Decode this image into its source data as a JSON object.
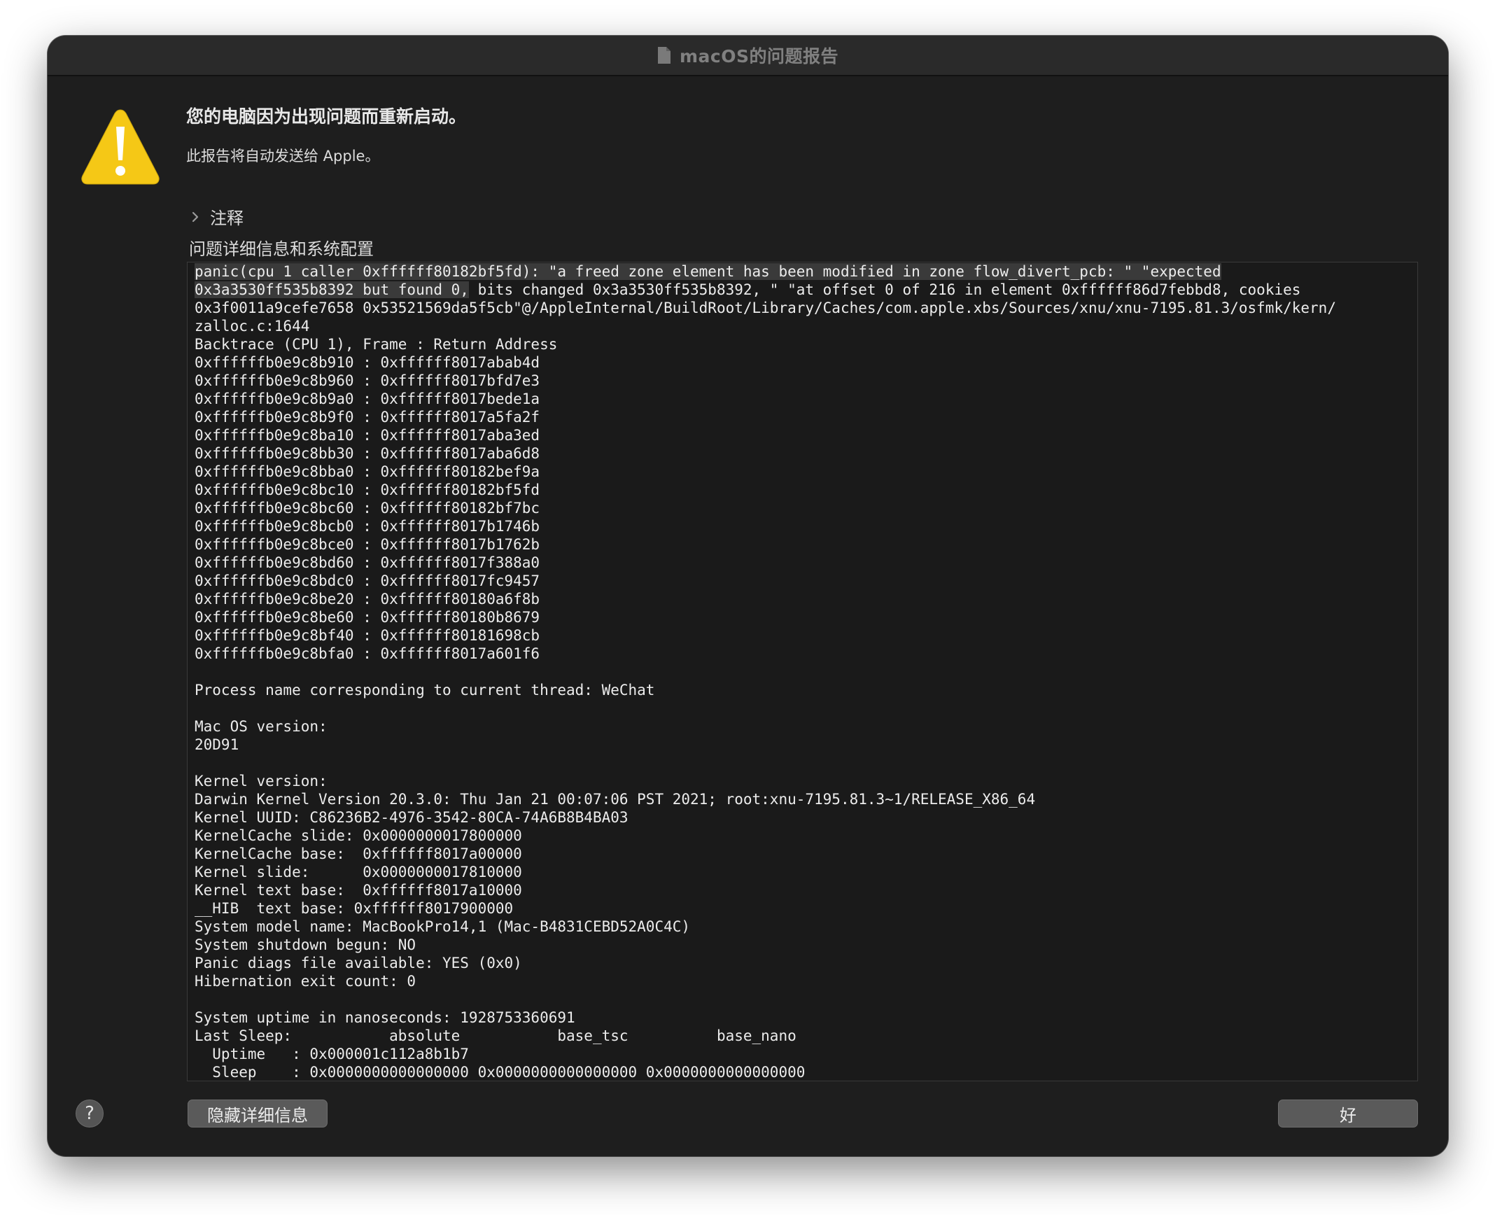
{
  "window": {
    "title": "macOS的问题报告",
    "title_icon": "document-icon"
  },
  "alert": {
    "icon": "warning-icon",
    "headline": "您的电脑因为出现问题而重新启动。",
    "subline": "此报告将自动发送给 Apple。"
  },
  "notes": {
    "label": "注释",
    "icon": "chevron-right-icon"
  },
  "details": {
    "heading": "问题详细信息和系统配置",
    "highlighted": "panic(cpu 1 caller 0xffffff80182bf5fd): \"a freed zone element has been modified in zone flow_divert_pcb: \" \"expected\n0x3a3530ff535b8392 but found 0,",
    "log": " bits changed 0x3a3530ff535b8392, \" \"at offset 0 of 216 in element 0xffffff86d7febbd8, cookies\n0x3f0011a9cefe7658 0x53521569da5f5cb\"@/AppleInternal/BuildRoot/Library/Caches/com.apple.xbs/Sources/xnu/xnu-7195.81.3/osfmk/kern/\nzalloc.c:1644\nBacktrace (CPU 1), Frame : Return Address\n0xffffffb0e9c8b910 : 0xffffff8017abab4d\n0xffffffb0e9c8b960 : 0xffffff8017bfd7e3\n0xffffffb0e9c8b9a0 : 0xffffff8017bede1a\n0xffffffb0e9c8b9f0 : 0xffffff8017a5fa2f\n0xffffffb0e9c8ba10 : 0xffffff8017aba3ed\n0xffffffb0e9c8bb30 : 0xffffff8017aba6d8\n0xffffffb0e9c8bba0 : 0xffffff80182bef9a\n0xffffffb0e9c8bc10 : 0xffffff80182bf5fd\n0xffffffb0e9c8bc60 : 0xffffff80182bf7bc\n0xffffffb0e9c8bcb0 : 0xffffff8017b1746b\n0xffffffb0e9c8bce0 : 0xffffff8017b1762b\n0xffffffb0e9c8bd60 : 0xffffff8017f388a0\n0xffffffb0e9c8bdc0 : 0xffffff8017fc9457\n0xffffffb0e9c8be20 : 0xffffff80180a6f8b\n0xffffffb0e9c8be60 : 0xffffff80180b8679\n0xffffffb0e9c8bf40 : 0xffffff80181698cb\n0xffffffb0e9c8bfa0 : 0xffffff8017a601f6\n\nProcess name corresponding to current thread: WeChat\n\nMac OS version:\n20D91\n\nKernel version:\nDarwin Kernel Version 20.3.0: Thu Jan 21 00:07:06 PST 2021; root:xnu-7195.81.3~1/RELEASE_X86_64\nKernel UUID: C86236B2-4976-3542-80CA-74A6B8B4BA03\nKernelCache slide: 0x0000000017800000\nKernelCache base:  0xffffff8017a00000\nKernel slide:      0x0000000017810000\nKernel text base:  0xffffff8017a10000\n__HIB  text base: 0xffffff8017900000\nSystem model name: MacBookPro14,1 (Mac-B4831CEBD52A0C4C)\nSystem shutdown begun: NO\nPanic diags file available: YES (0x0)\nHibernation exit count: 0\n\nSystem uptime in nanoseconds: 1928753360691\nLast Sleep:           absolute           base_tsc          base_nano\n  Uptime   : 0x000001c112a8b1b7\n  Sleep    : 0x0000000000000000 0x0000000000000000 0x0000000000000000"
  },
  "buttons": {
    "help": "?",
    "hide_details": "隐藏详细信息",
    "ok": "好"
  }
}
